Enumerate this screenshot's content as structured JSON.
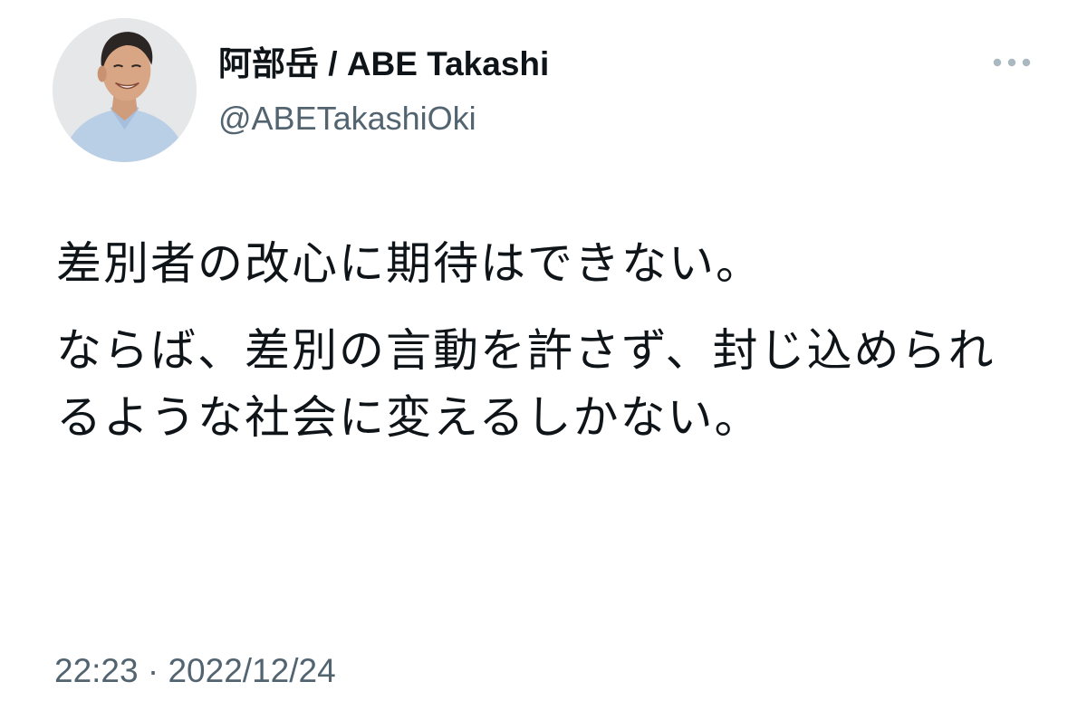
{
  "author": {
    "display_name": "阿部岳 / ABE Takashi",
    "handle": "@ABETakashiOki"
  },
  "tweet": {
    "paragraphs": [
      "差別者の改心に期待はできない。",
      "ならば、差別の言動を許さず、封じ込められるような社会に変えるしかない。"
    ],
    "time": "22:23",
    "separator": "·",
    "date": "2022/12/24"
  },
  "icons": {
    "more": "more-horizontal-icon"
  },
  "colors": {
    "text_primary": "#0f1419",
    "text_secondary": "#536471",
    "background": "#ffffff"
  }
}
